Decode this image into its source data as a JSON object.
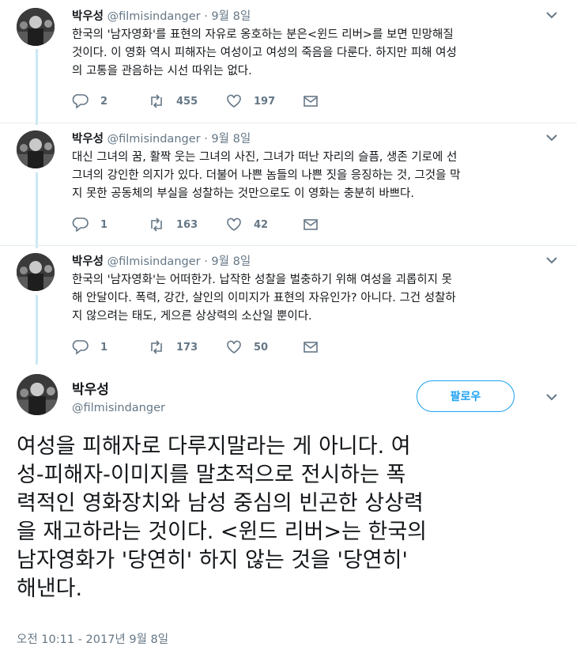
{
  "thread": [
    {
      "name": "박우성",
      "meta": "@filmisindanger · 9월 8일",
      "text_lines": [
        "한국의 '남자영화'를 표현의 자유로 옹호하는 분은<윈드 리버>를 보면 민망해질",
        "것이다. 이 영화 역시 피해자는 여성이고 여성의 죽음을 다룬다. 하지만 피해 여성",
        "의 고통을 관음하는 시선 따위는 없다."
      ],
      "replies": "2",
      "retweets": "455",
      "likes": "197"
    },
    {
      "name": "박우성",
      "meta": "@filmisindanger · 9월 8일",
      "text_lines": [
        "대신 그녀의 꿈, 활짝 웃는 그녀의 사진, 그녀가 떠난 자리의 슬픔, 생존 기로에 선",
        "그녀의 강인한 의지가 있다. 더불어 나쁜 놈들의 나쁜 짓을 응징하는 것, 그것을 막",
        "지 못한 공동체의 부실을 성찰하는 것만으로도 이 영화는 충분히 바쁘다."
      ],
      "replies": "1",
      "retweets": "163",
      "likes": "42"
    },
    {
      "name": "박우성",
      "meta": "@filmisindanger · 9월 8일",
      "text_lines": [
        "한국의 '남자영화'는 어떠한가. 납작한 성찰을 벌충하기 위해 여성을 괴롭히지 못",
        "해 안달이다. 폭력, 강간, 살인의 이미지가 표현의 자유인가? 아니다. 그건 성찰하",
        "지 않으려는 태도, 게으른 상상력의 소산일 뿐이다."
      ],
      "replies": "1",
      "retweets": "173",
      "likes": "50"
    }
  ],
  "main": {
    "name": "박우성",
    "handle": "@filmisindanger",
    "follow_label": "팔로우",
    "text_lines": [
      "여성을 피해자로 다루지말라는 게 아니다. 여",
      "성-피해자-이미지를 말초적으로 전시하는 폭",
      "력적인 영화장치와 남성 중심의 빈곤한 상상력",
      "을 재고하라는 것이다. <윈드 리버>는 한국의",
      "남자영화가 '당연히' 하지 않는 것을 '당연히'",
      "해낸다."
    ],
    "timestamp": "오전 10:11 - 2017년 9월 8일"
  },
  "icons": {
    "reply": "reply-icon",
    "retweet": "retweet-icon",
    "like": "heart-icon",
    "dm": "envelope-icon",
    "more": "chevron-down-icon"
  },
  "colors": {
    "accent": "#1da1f2",
    "muted": "#657786",
    "thread_line": "#cbe8f5"
  }
}
